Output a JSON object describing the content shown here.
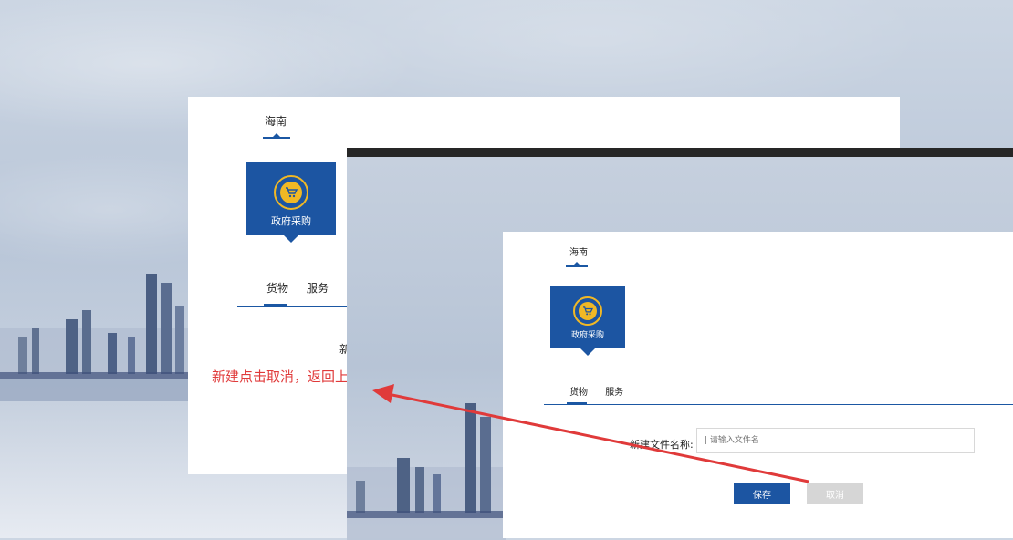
{
  "back_panel": {
    "region_tab": "海南",
    "tile_label": "政府采购",
    "sub_tabs": [
      "货物",
      "服务"
    ],
    "partial_text": "新"
  },
  "annotation": "新建点击取消，返回上一级",
  "front_panel": {
    "region_tab": "海南",
    "tile_label": "政府采购",
    "sub_tabs": [
      "货物",
      "服务"
    ],
    "form": {
      "name_label": "新建文件名称:",
      "name_placeholder": "| 请输入文件名",
      "save_label": "保存",
      "cancel_label": "取消"
    }
  },
  "colors": {
    "primary": "#1c55a2",
    "accent": "#f0b825",
    "annotation": "#e03a3a",
    "window_bar": "#262626"
  },
  "icons": [
    "cart-icon"
  ]
}
